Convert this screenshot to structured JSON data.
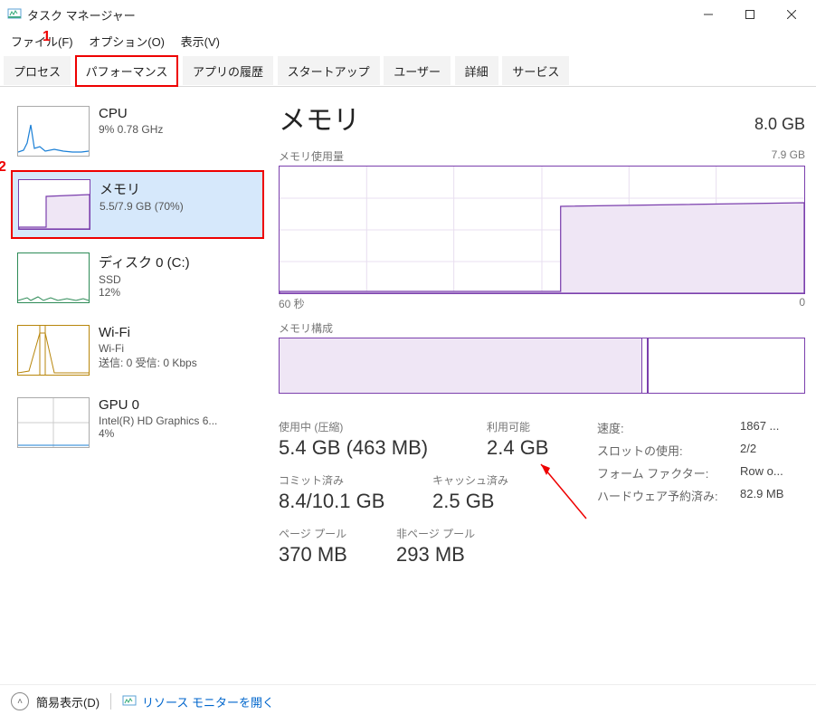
{
  "window": {
    "title": "タスク マネージャー"
  },
  "menu": {
    "file": "ファイル(F)",
    "options": "オプション(O)",
    "view": "表示(V)"
  },
  "tabs": {
    "processes": "プロセス",
    "performance": "パフォーマンス",
    "app_history": "アプリの履歴",
    "startup": "スタートアップ",
    "users": "ユーザー",
    "details": "詳細",
    "services": "サービス"
  },
  "sidebar": {
    "cpu": {
      "title": "CPU",
      "sub": "9%  0.78 GHz"
    },
    "memory": {
      "title": "メモリ",
      "sub": "5.5/7.9 GB (70%)"
    },
    "disk": {
      "title": "ディスク 0 (C:)",
      "sub1": "SSD",
      "sub2": "12%"
    },
    "wifi": {
      "title": "Wi-Fi",
      "sub1": "Wi-Fi",
      "sub2": "送信: 0 受信: 0 Kbps"
    },
    "gpu": {
      "title": "GPU 0",
      "sub1": "Intel(R) HD Graphics 6...",
      "sub2": "4%"
    }
  },
  "main": {
    "title": "メモリ",
    "total": "8.0 GB",
    "usage_label": "メモリ使用量",
    "usage_max": "7.9 GB",
    "axis_left": "60 秒",
    "axis_right": "0",
    "comp_label": "メモリ構成",
    "stats": {
      "in_use_label": "使用中 (圧縮)",
      "in_use": "5.4 GB (463 MB)",
      "avail_label": "利用可能",
      "avail": "2.4 GB",
      "commit_label": "コミット済み",
      "commit": "8.4/10.1 GB",
      "cached_label": "キャッシュ済み",
      "cached": "2.5 GB",
      "paged_label": "ページ プール",
      "paged": "370 MB",
      "nonpaged_label": "非ページ プール",
      "nonpaged": "293 MB"
    },
    "props": {
      "speed_k": "速度:",
      "speed_v": "1867 ...",
      "slots_k": "スロットの使用:",
      "slots_v": "2/2",
      "form_k": "フォーム ファクター:",
      "form_v": "Row o...",
      "hw_k": "ハードウェア予約済み:",
      "hw_v": "82.9 MB"
    }
  },
  "footer": {
    "simple": "簡易表示(D)",
    "resmon": "リソース モニターを開く"
  },
  "annotations": {
    "m1": "1",
    "m2": "2"
  }
}
